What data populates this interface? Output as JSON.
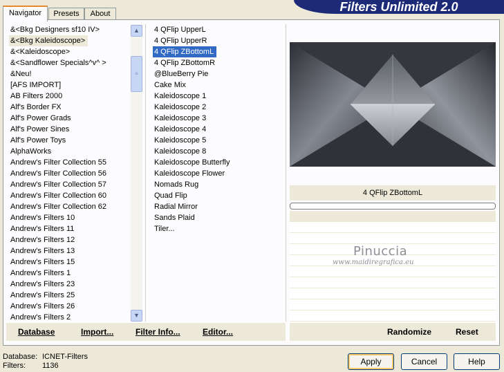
{
  "app": {
    "title": "Filters Unlimited 2.0"
  },
  "tabs": [
    {
      "label": "Navigator"
    },
    {
      "label": "Presets"
    },
    {
      "label": "About"
    }
  ],
  "categories": [
    "&<Bkg Designers sf10 IV>",
    "&<Bkg Kaleidoscope>",
    "&<Kaleidoscope>",
    "&<Sandflower Specials^v^ >",
    "&Neu!",
    "[AFS IMPORT]",
    "AB Filters 2000",
    "Alf's Border FX",
    "Alf's Power Grads",
    "Alf's Power Sines",
    "Alf's Power Toys",
    "AlphaWorks",
    "Andrew's Filter Collection 55",
    "Andrew's Filter Collection 56",
    "Andrew's Filter Collection 57",
    "Andrew's Filter Collection 60",
    "Andrew's Filter Collection 62",
    "Andrew's Filters 10",
    "Andrew's Filters 11",
    "Andrew's Filters 12",
    "Andrew's Filters 13",
    "Andrew's Filters 15",
    "Andrew's Filters 1",
    "Andrew's Filters 23",
    "Andrew's Filters 25",
    "Andrew's Filters 26",
    "Andrew's Filters 2"
  ],
  "categories_selected_index": 1,
  "filters": [
    "4 QFlip UpperL",
    "4 QFlip UpperR",
    "4 QFlip ZBottomL",
    "4 QFlip ZBottomR",
    "@BlueBerry Pie",
    "Cake Mix",
    "Kaleidoscope 1",
    "Kaleidoscope 2",
    "Kaleidoscope 3",
    "Kaleidoscope 4",
    "Kaleidoscope 5",
    "Kaleidoscope 8",
    "Kaleidoscope Butterfly",
    "Kaleidoscope Flower",
    "Nomads Rug",
    "Quad Flip",
    "Radial Mirror",
    "Sands Plaid",
    "Tiler..."
  ],
  "filters_selected_index": 2,
  "current_filter_name": "4 QFlip ZBottomL",
  "watermark": {
    "name": "Pinuccia",
    "url": "www.maidiregrafica.eu"
  },
  "bottom_left_buttons": {
    "database": "Database",
    "import": "Import...",
    "filter_info": "Filter Info...",
    "editor": "Editor..."
  },
  "bottom_right_buttons": {
    "randomize": "Randomize",
    "reset": "Reset"
  },
  "status": {
    "database_label": "Database:",
    "database_value": "ICNET-Filters",
    "filters_label": "Filters:",
    "filters_value": "1136"
  },
  "dialog_buttons": {
    "apply": "Apply",
    "cancel": "Cancel",
    "help": "Help"
  },
  "icons": {
    "scroll_up": "chevron-up-icon",
    "scroll_down": "chevron-down-icon",
    "scroll_grip": "grip-icon"
  },
  "colors": {
    "banner": "#1c2a78",
    "selection": "#316ac5",
    "dialog_bg": "#ece9d8"
  }
}
